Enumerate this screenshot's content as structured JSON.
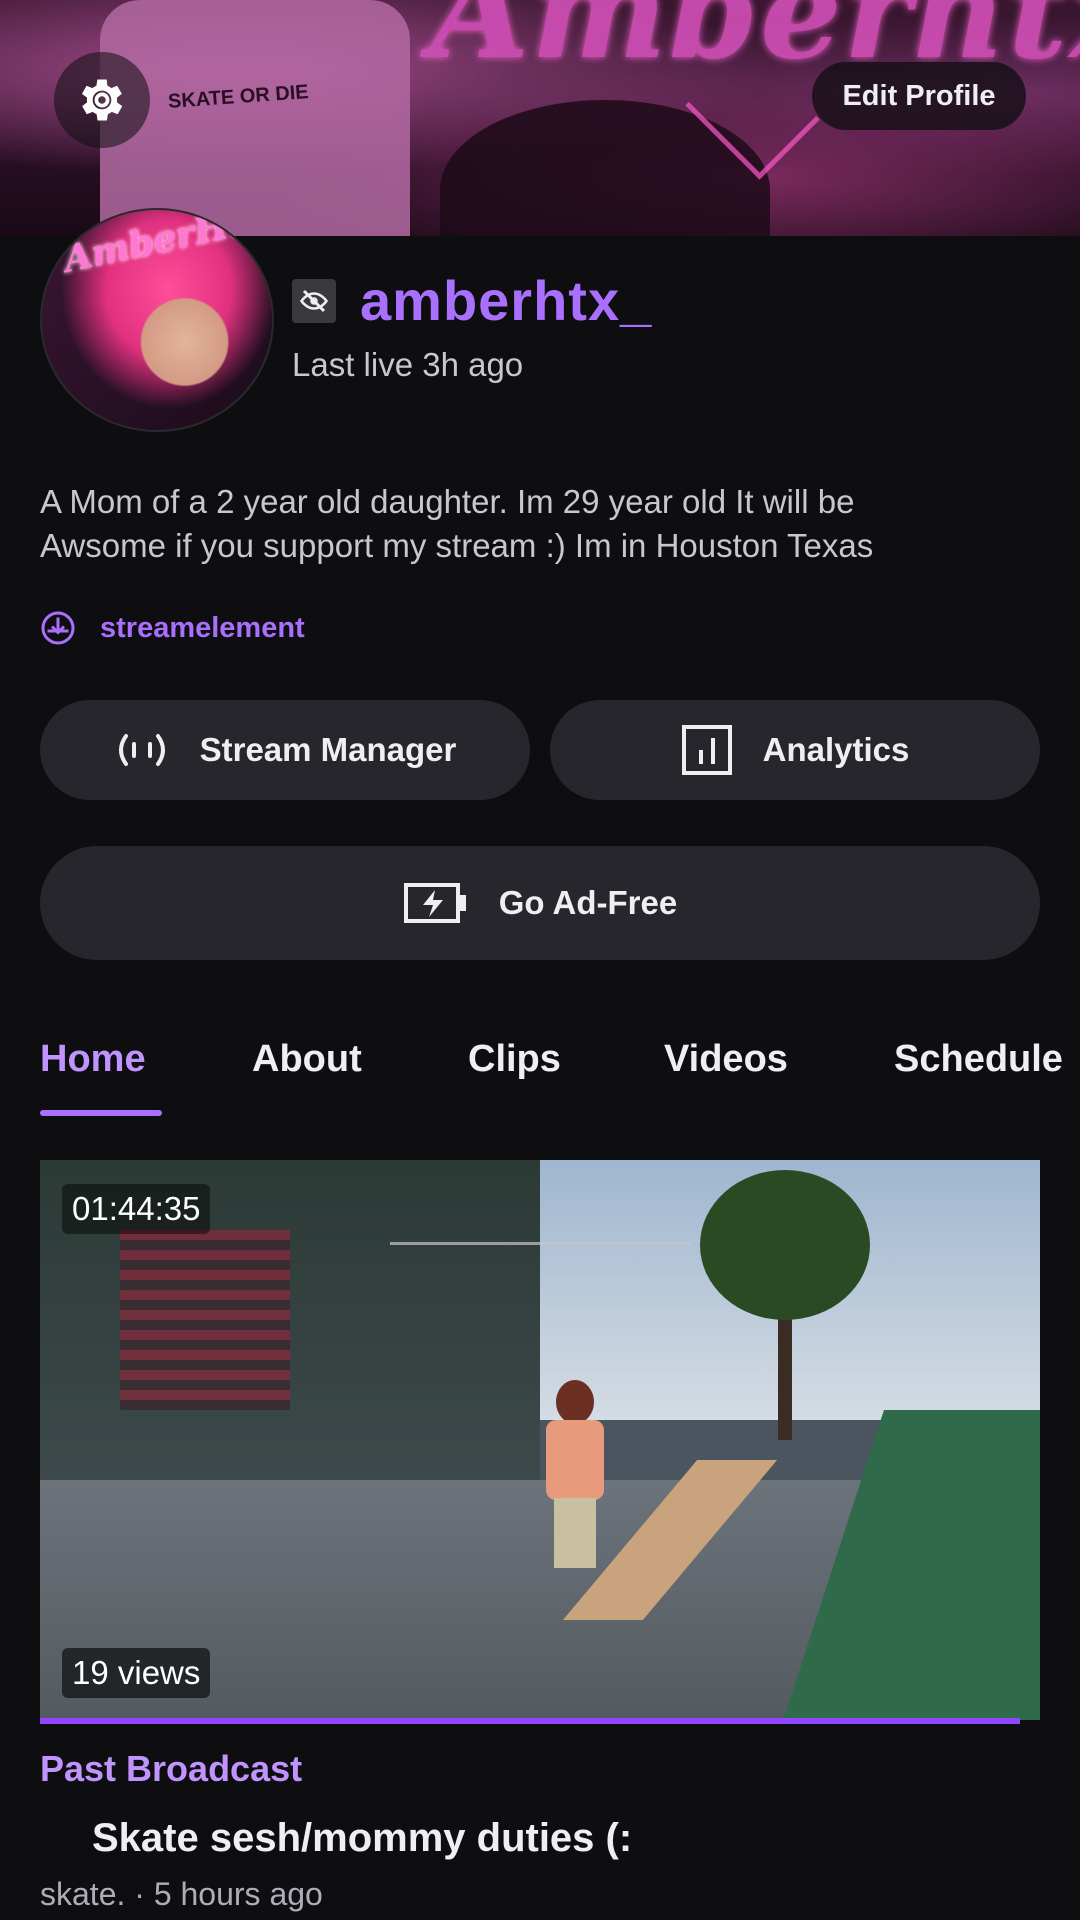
{
  "banner": {
    "title_art": "Amberhtx",
    "shirt_text": "SKATE OR DIE",
    "edit_profile_label": "Edit Profile",
    "settings_icon": "gear-icon"
  },
  "profile": {
    "avatar_signature": "AmberHtx",
    "username": "amberhtx_",
    "last_live": "Last live 3h ago",
    "bio": "A Mom of a 2 year old daughter.   Im 29 year old It will be\nAwsome if you support my stream :) Im in  Houston Texas",
    "link_label": "streamelement",
    "link_icon": "link-icon",
    "status_icon": "offline-eye-icon",
    "accent_color": "#a970ff"
  },
  "actions": {
    "stream_manager_label": "Stream Manager",
    "analytics_label": "Analytics",
    "ad_free_label": "Go Ad-Free"
  },
  "tabs": [
    {
      "label": "Home",
      "active": true
    },
    {
      "label": "About",
      "active": false
    },
    {
      "label": "Clips",
      "active": false
    },
    {
      "label": "Videos",
      "active": false
    },
    {
      "label": "Schedule",
      "active": false
    }
  ],
  "video": {
    "duration": "01:44:35",
    "views": "19 views",
    "type_label": "Past Broadcast",
    "title": "Skate sesh/mommy duties (:",
    "meta": "skate. · 5 hours ago",
    "watch_progress_percent": 98
  }
}
